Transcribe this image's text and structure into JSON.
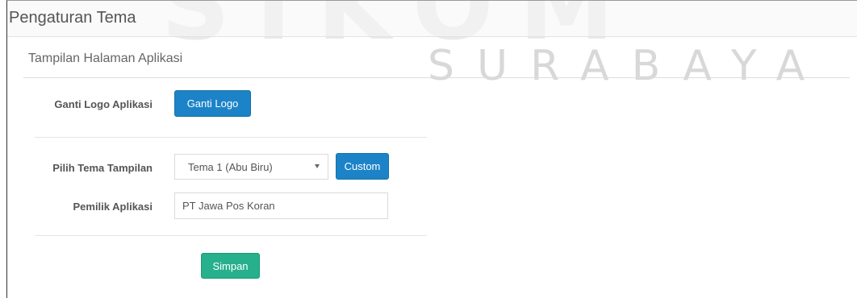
{
  "watermark": {
    "big": "SIKOM",
    "small": "SURABAYA"
  },
  "page": {
    "title": "Pengaturan Tema"
  },
  "panel": {
    "title": "Tampilan Halaman Aplikasi"
  },
  "form": {
    "logo_label": "Ganti Logo Aplikasi",
    "logo_button": "Ganti Logo",
    "theme_label": "Pilih Tema Tampilan",
    "theme_selected": "Tema 1 (Abu Biru)",
    "custom_button": "Custom",
    "owner_label": "Pemilik Aplikasi",
    "owner_value": "PT Jawa Pos Koran",
    "save_button": "Simpan"
  },
  "colors": {
    "primary": "#1c83c8",
    "success": "#27b08c",
    "watermark": "#eaeaea"
  }
}
